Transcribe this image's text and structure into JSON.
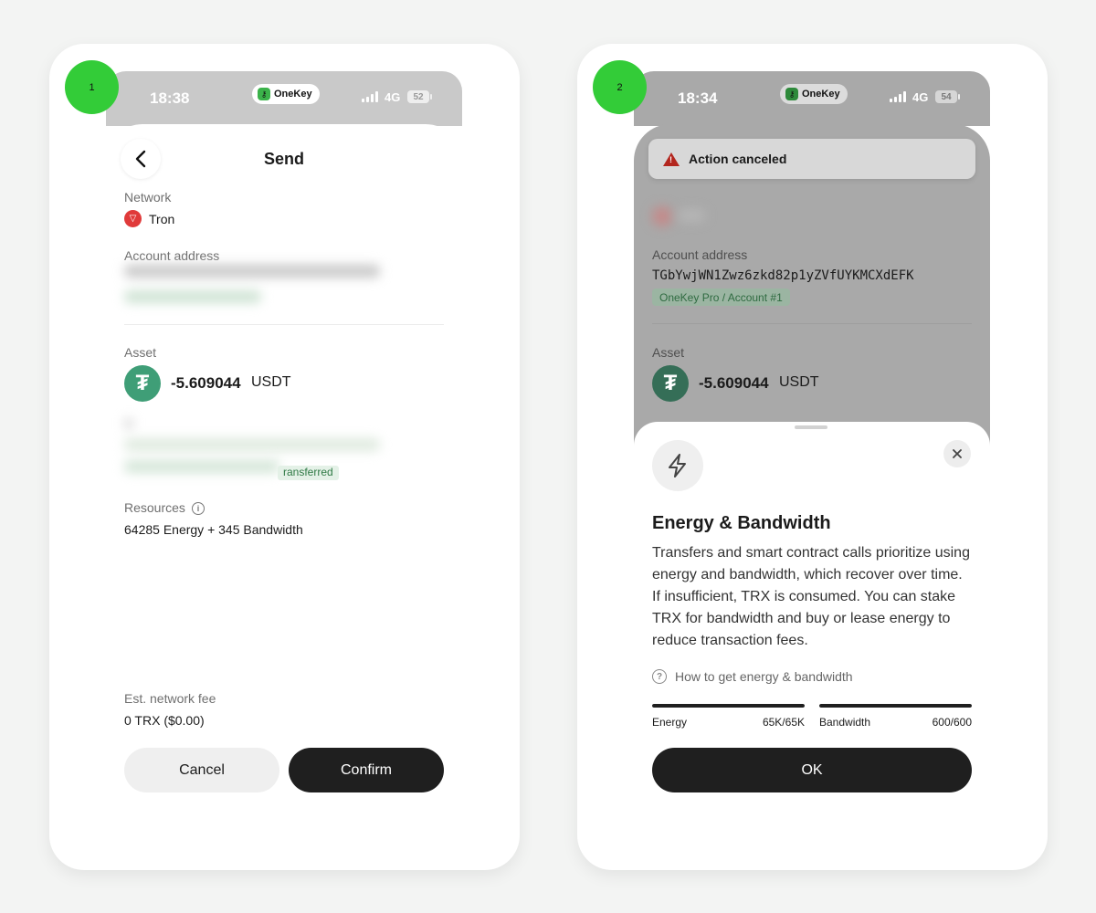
{
  "steps": [
    "1",
    "2"
  ],
  "brand": {
    "name": "OneKey"
  },
  "screen1": {
    "status": {
      "time": "18:38",
      "network": "4G",
      "battery": "52"
    },
    "header": {
      "title": "Send"
    },
    "network": {
      "label": "Network",
      "value": "Tron"
    },
    "account": {
      "label": "Account address"
    },
    "asset": {
      "label": "Asset",
      "amount": "-5.609044",
      "unit": "USDT"
    },
    "partial_text": "ransferred",
    "resources": {
      "label": "Resources",
      "value": "64285 Energy + 345 Bandwidth"
    },
    "fee": {
      "label": "Est. network fee",
      "value": "0 TRX ($0.00)"
    },
    "buttons": {
      "cancel": "Cancel",
      "confirm": "Confirm"
    }
  },
  "screen2": {
    "status": {
      "time": "18:34",
      "network": "4G",
      "battery": "54"
    },
    "toast": {
      "text": "Action canceled"
    },
    "account": {
      "label": "Account address",
      "address": "TGbYwjWN1Zwz6zkd82p1yZVfUYKMCXdEFK",
      "tag": "OneKey Pro / Account #1"
    },
    "asset": {
      "label": "Asset",
      "amount": "-5.609044",
      "unit": "USDT"
    },
    "modal": {
      "title": "Energy & Bandwidth",
      "body": "Transfers and smart contract calls prioritize using energy and bandwidth, which recover over time. If insufficient, TRX is consumed. You can stake TRX for bandwidth and buy or lease energy to reduce transaction fees.",
      "help_link": "How to get energy & bandwidth",
      "energy": {
        "label": "Energy",
        "value": "65K/65K",
        "fraction": 1.0
      },
      "bandwidth": {
        "label": "Bandwidth",
        "value": "600/600",
        "fraction": 1.0
      },
      "ok": "OK"
    }
  },
  "colors": {
    "step_badge": "#33cc38",
    "tron_red": "#e03a3a",
    "tether_green": "#3f9e77",
    "warning_red": "#b3261e",
    "primary_button": "#1f1f1f"
  }
}
